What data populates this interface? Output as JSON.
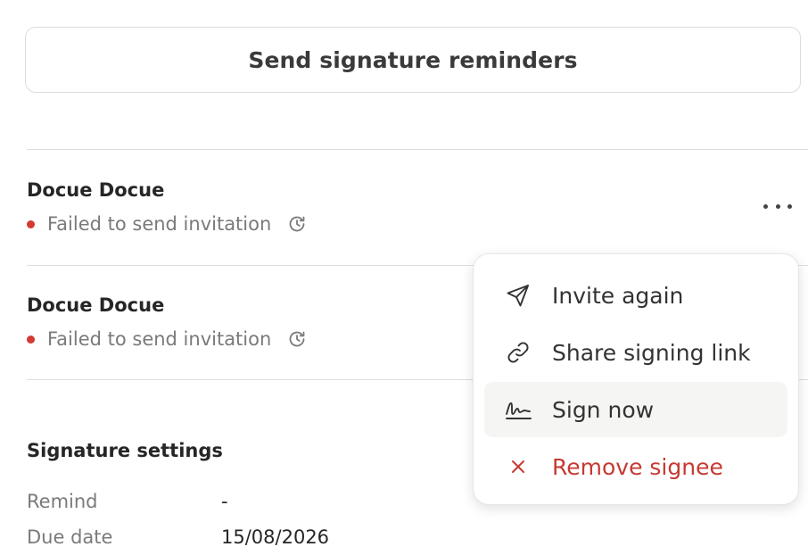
{
  "reminder_button": {
    "label": "Send signature reminders"
  },
  "signees": [
    {
      "name": "Docue Docue",
      "status": "Failed to send invitation",
      "status_color": "#d33a32"
    },
    {
      "name": "Docue Docue",
      "status": "Failed to send invitation",
      "status_color": "#d33a32"
    }
  ],
  "menu": {
    "items": [
      {
        "label": "Invite again",
        "icon": "send-icon"
      },
      {
        "label": "Share signing link",
        "icon": "link-icon"
      },
      {
        "label": "Sign now",
        "icon": "signature-icon"
      },
      {
        "label": "Remove signee",
        "icon": "close-icon"
      }
    ],
    "danger_color": "#c63a32"
  },
  "settings": {
    "title": "Signature settings",
    "rows": [
      {
        "label": "Remind",
        "value": "-"
      },
      {
        "label": "Due date",
        "value": "15/08/2026"
      }
    ]
  }
}
